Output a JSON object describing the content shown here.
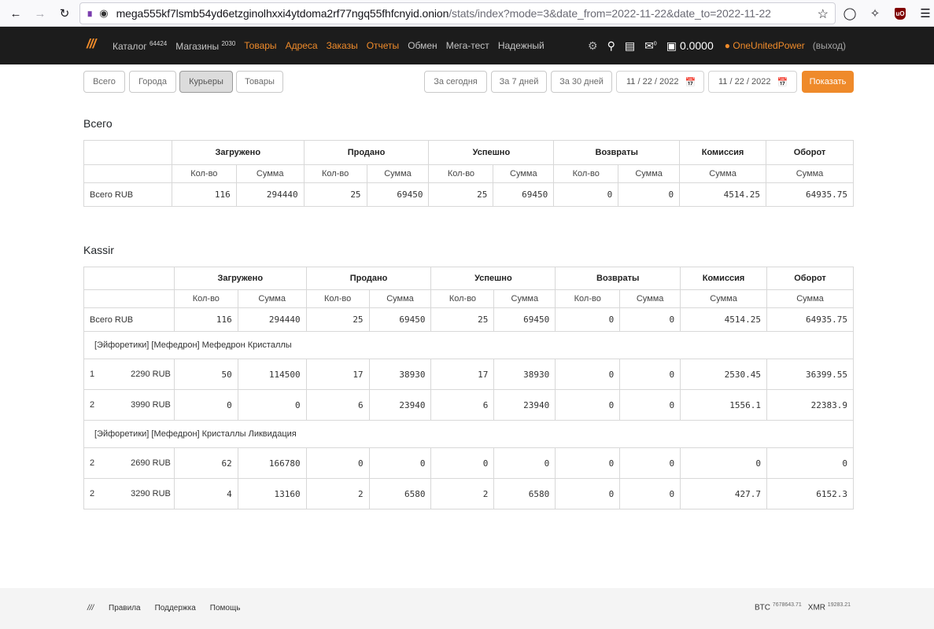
{
  "browser": {
    "url_host": "mega555kf7lsmb54yd6etzginolhxxi4ytdoma2rf77ngq55fhfcnyid.onion",
    "url_path": "/stats/index?mode=3&date_from=2022-11-22&date_to=2022-11-22",
    "ublock_label": "uO"
  },
  "nav": {
    "brand": "///",
    "items": [
      {
        "label": "Каталог",
        "sup": "64424"
      },
      {
        "label": "Магазины",
        "sup": "2030"
      },
      {
        "label": "Товары",
        "sup": ""
      },
      {
        "label": "Адреса",
        "sup": ""
      },
      {
        "label": "Заказы",
        "sup": ""
      },
      {
        "label": "Отчеты",
        "sup": ""
      },
      {
        "label": "Обмен",
        "sup": ""
      },
      {
        "label": "Мега-тест",
        "sup": ""
      },
      {
        "label": "Надежный",
        "sup": ""
      }
    ],
    "mail_count": "0",
    "balance": "0.0000",
    "user": "OneUnitedPower",
    "logout": "(выход)"
  },
  "filters": {
    "mode_buttons": [
      "Всего",
      "Города",
      "Курьеры",
      "Товары"
    ],
    "active_mode": "Курьеры",
    "period_buttons": [
      "За сегодня",
      "За 7 дней",
      "За 30 дней"
    ],
    "date_from": "11 / 22 / 2022",
    "date_to": "11 / 22 / 2022",
    "submit": "Показать"
  },
  "headers": {
    "groups": [
      "Загружено",
      "Продано",
      "Успешно",
      "Возвраты",
      "Комиссия",
      "Оборот"
    ],
    "qty": "Кол-во",
    "sum": "Сумма"
  },
  "total_section": {
    "title": "Всего",
    "row": {
      "label": "Всего RUB",
      "values": [
        "116",
        "294440",
        "25",
        "69450",
        "25",
        "69450",
        "0",
        "0",
        "4514.25",
        "64935.75"
      ]
    }
  },
  "kassir_section": {
    "title": "Kassir",
    "total_row": {
      "label": "Всего RUB",
      "values": [
        "116",
        "294440",
        "25",
        "69450",
        "25",
        "69450",
        "0",
        "0",
        "4514.25",
        "64935.75"
      ]
    },
    "groups": [
      {
        "name": "[Эйфоретики] [Мефедрон] Мефедрон Кристаллы",
        "rows": [
          {
            "idx": "1",
            "price": "2290 RUB",
            "values": [
              "50",
              "114500",
              "17",
              "38930",
              "17",
              "38930",
              "0",
              "0",
              "2530.45",
              "36399.55"
            ]
          },
          {
            "idx": "2",
            "price": "3990 RUB",
            "values": [
              "0",
              "0",
              "6",
              "23940",
              "6",
              "23940",
              "0",
              "0",
              "1556.1",
              "22383.9"
            ]
          }
        ]
      },
      {
        "name": "[Эйфоретики] [Мефедрон] Кристаллы Ликвидация",
        "rows": [
          {
            "idx": "2",
            "price": "2690 RUB",
            "values": [
              "62",
              "166780",
              "0",
              "0",
              "0",
              "0",
              "0",
              "0",
              "0",
              "0"
            ]
          },
          {
            "idx": "2",
            "price": "3290 RUB",
            "values": [
              "4",
              "13160",
              "2",
              "6580",
              "2",
              "6580",
              "0",
              "0",
              "427.7",
              "6152.3"
            ]
          }
        ]
      }
    ]
  },
  "footer": {
    "brand": "///",
    "links": [
      "Правила",
      "Поддержка",
      "Помощь"
    ],
    "btc_label": "BTC",
    "btc_value": "7678643.71",
    "xmr_label": "XMR",
    "xmr_value": "19283.21"
  },
  "colors": {
    "accent": "#ef8a2a",
    "navbar": "#1c1c1c"
  }
}
